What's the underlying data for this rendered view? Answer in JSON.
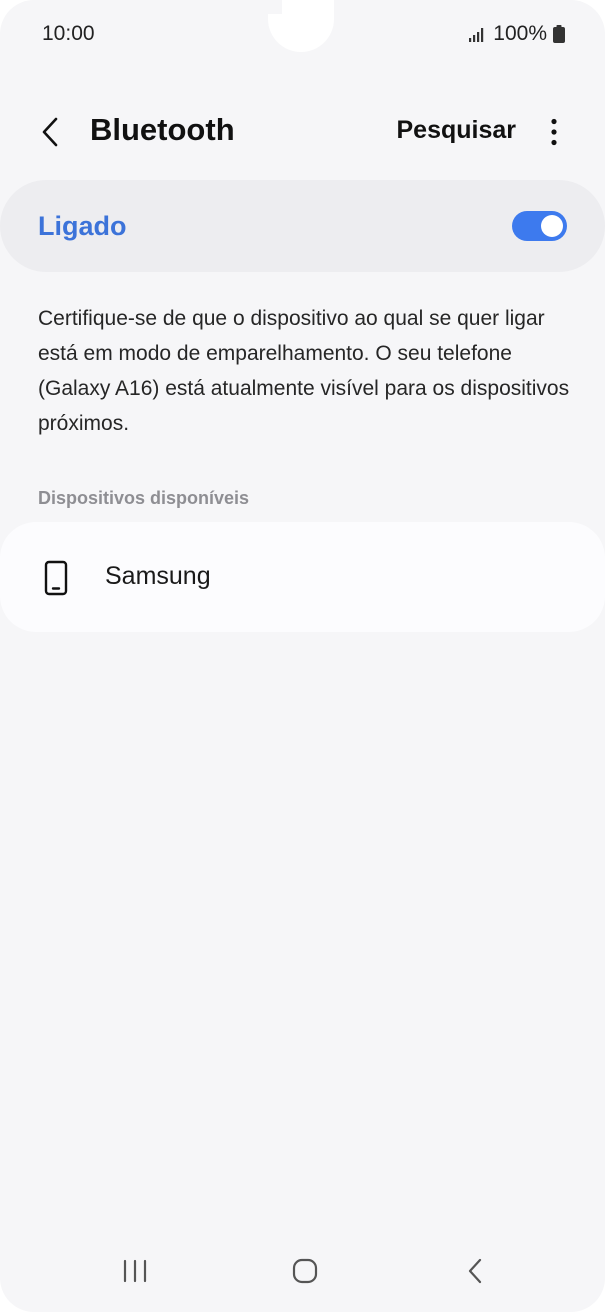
{
  "status_bar": {
    "time": "10:00",
    "battery": "100%"
  },
  "header": {
    "title": "Bluetooth",
    "search_label": "Pesquisar",
    "back_icon": "chevron-left-icon",
    "more_icon": "more-vertical-icon"
  },
  "bluetooth_toggle": {
    "label": "Ligado",
    "state": "on",
    "accent_color": "#3d7aee",
    "label_color": "#3c73d9"
  },
  "description": "Certifique-se de que o dispositivo ao qual se quer ligar está em modo de emparelhamento. O seu telefone (Galaxy A16) está atualmente visível para os dispositivos próximos.",
  "available_devices": {
    "header": "Dispositivos disponíveis",
    "items": [
      {
        "name": "Samsung",
        "icon": "smartphone-icon"
      }
    ]
  },
  "nav_bar": {
    "icons": [
      "recents-icon",
      "home-icon",
      "back-icon"
    ]
  }
}
